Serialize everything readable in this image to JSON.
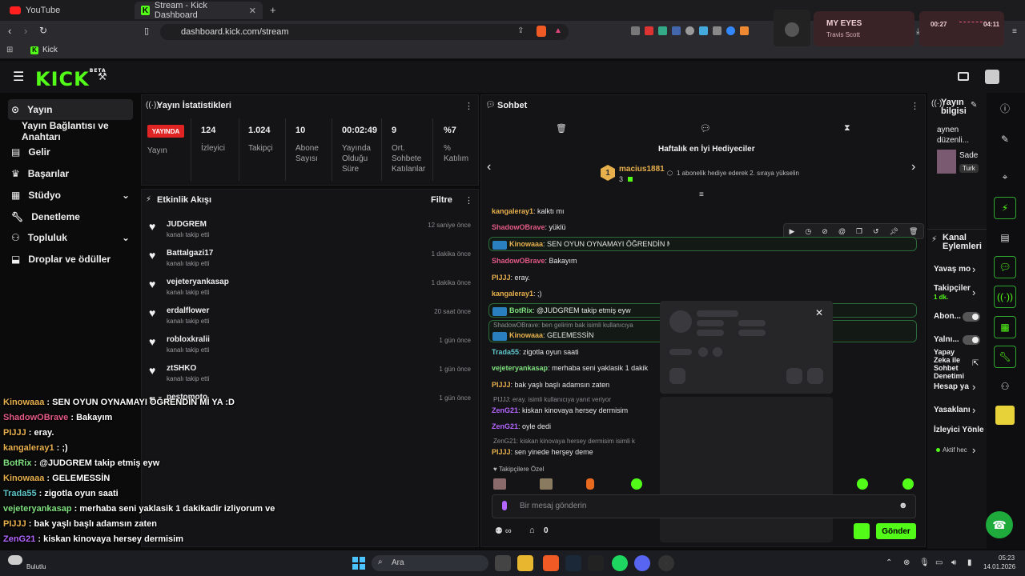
{
  "browser": {
    "tabs": [
      "YouTube",
      "Stream - Kick Dashboard"
    ],
    "url": "dashboard.kick.com/stream",
    "bookmark": "Kick"
  },
  "media": {
    "title": "MY EYES",
    "artist": "Travis Scott",
    "elapsed": "00:27",
    "total": "04:11"
  },
  "nav": {
    "items": [
      "Yayın",
      "Yayın Bağlantısı ve Anahtarı",
      "Gelir",
      "Başarılar",
      "Stüdyo",
      "Denetleme",
      "Topluluk",
      "Droplar ve ödüller"
    ]
  },
  "stats": {
    "title": "Yayın İstatistikleri",
    "live": "YAYINDA",
    "live_label": "Yayın",
    "items": [
      {
        "value": "124",
        "label": "İzleyici"
      },
      {
        "value": "1.024",
        "label": "Takipçi"
      },
      {
        "value": "10",
        "label": "Abone Sayısı"
      },
      {
        "value": "00:02:49",
        "label": "Yayında Olduğu Süre"
      },
      {
        "value": "9",
        "label": "Ort. Sohbete Katılanlar"
      },
      {
        "value": "%7",
        "label": "% Katılım"
      }
    ]
  },
  "feed": {
    "title": "Etkinlik Akışı",
    "filter": "Filtre",
    "events": [
      {
        "name": "JUDGREM",
        "sub": "kanalı takip etti",
        "time": "12 saniye önce"
      },
      {
        "name": "Battalgazi17",
        "sub": "kanalı takip etti",
        "time": "1 dakika önce"
      },
      {
        "name": "vejeteryankasap",
        "sub": "kanalı takip etti",
        "time": "1 dakika önce"
      },
      {
        "name": "erdalflower",
        "sub": "kanalı takip etti",
        "time": "20 saat önce"
      },
      {
        "name": "robloxkralii",
        "sub": "kanalı takip etti",
        "time": "1 gün önce"
      },
      {
        "name": "ztSHKO",
        "sub": "kanalı takip etti",
        "time": "1 gün önce"
      },
      {
        "name": "pestomoto",
        "sub": "",
        "time": "1 gün önce"
      }
    ]
  },
  "chat": {
    "title": "Sohbet",
    "gifters_title": "Haftalık en İyi Hediyeciler",
    "top_gifter": "macius1881",
    "top_gifter_count": "3",
    "gifter_hint": "1 abonelik hediye ederek 2. sıraya yükselin",
    "followers_only": "Takipçilere Özel",
    "placeholder": "Bir mesaj gönderin",
    "send": "Gönder",
    "count": "0",
    "messages": [
      {
        "user": "kangaleray1",
        "text": ": kalktı mı",
        "cls": "u-orange"
      },
      {
        "user": "ShadowOBrave",
        "text": ": yüklü",
        "cls": "u-pink"
      },
      {
        "user": "Kinowaaa",
        "text": ": SEN OYUN OYNAMAYI ÖĞRENDİN Mİ YA :D",
        "cls": "u-orange"
      },
      {
        "user": "ShadowOBrave",
        "text": ": Bakayım",
        "cls": "u-pink"
      },
      {
        "user": "PIJJJ",
        "text": ": eray.",
        "cls": "u-orange"
      },
      {
        "user": "kangaleray1",
        "text": ": ;)",
        "cls": "u-orange"
      },
      {
        "user": "BotRix",
        "text": ": @JUDGREM takip etmiş eyw",
        "cls": "u-lime"
      },
      {
        "user": "ShadowOBrave: ben gelirim bak isimli kullanıcıya",
        "text": "",
        "cls": ""
      },
      {
        "user": "Kinowaaa",
        "text": ": GELEMESSİN",
        "cls": "u-orange"
      },
      {
        "user": "Trada55",
        "text": ": zigotla oyun saati",
        "cls": "u-teal"
      },
      {
        "user": "vejeteryankasap",
        "text": ": merhaba seni yaklasik 1 dakik",
        "cls": "u-lime"
      },
      {
        "user": "PIJJJ",
        "text": ": bak yaşlı başlı adamsın zaten",
        "cls": "u-orange"
      },
      {
        "user": "PIJJJ: eray. isimli kullanıcıya yanıt veriyor",
        "text": "",
        "cls": ""
      },
      {
        "user": "ZenG21",
        "text": ": kiskan kinovaya hersey dermisim",
        "cls": "u-violet"
      },
      {
        "user": "ZenG21",
        "text": ": oyle dedi",
        "cls": "u-violet"
      },
      {
        "user": "ZenG21: kiskan kinovaya hersey dermisim isimli k",
        "text": "",
        "cls": ""
      },
      {
        "user": "PIJJJ",
        "text": ": sen yinede herşey deme",
        "cls": "u-orange"
      }
    ]
  },
  "overlay": [
    {
      "user": "Kinowaaa",
      "text": " : SEN OYUN OYNAMAYI ÖĞRENDİN Mİ YA :D",
      "color": "#e8b04d"
    },
    {
      "user": "ShadowOBrave",
      "text": " : Bakayım",
      "color": "#e35a86"
    },
    {
      "user": "PIJJJ",
      "text": " : eray.",
      "color": "#e8b04d"
    },
    {
      "user": "kangaleray1",
      "text": " : ;)",
      "color": "#e8b04d"
    },
    {
      "user": "BotRix",
      "text": " : @JUDGREM takip etmiş eyw",
      "color": "#7fe07f"
    },
    {
      "user": "Kinowaaa",
      "text": " : GELEMESSİN",
      "color": "#e8b04d"
    },
    {
      "user": "Trada55",
      "text": " : zigotla oyun saati",
      "color": "#5fc6c9"
    },
    {
      "user": "vejeteryankasap",
      "text": " : merhaba seni yaklasik 1 dakikadir izliyorum ve",
      "color": "#7fe07f"
    },
    {
      "user": "PIJJJ",
      "text": " : bak yaşlı başlı adamsın zaten",
      "color": "#e8b04d"
    },
    {
      "user": "ZenG21",
      "text": " : kiskan kinovaya hersey dermisim",
      "color": "#b366ff"
    },
    {
      "user": "ZenG21",
      "text": " : oyle dedi",
      "color": "#b366ff"
    }
  ],
  "info": {
    "title": "Yayın bilgisi",
    "desc": "aynen düzenli...",
    "cat": "Sade",
    "tag": "Turk"
  },
  "actions": {
    "title": "Kanal Eylemleri",
    "slow": "Yavaş mo",
    "followers": "Takipçiler",
    "followers_val": "1 dk.",
    "subs": "Abon...",
    "only": "Yalnı...",
    "ai": "Yapay Zeka ile Sohbet Denetimi",
    "account": "Hesap ya",
    "banned": "Yasaklanı",
    "viewer": "İzleyici Yönle",
    "active": "Aktif hec"
  },
  "taskbar": {
    "search": "Ara",
    "weather": "Bulutlu",
    "time": "05:23",
    "date": "14.01.2026"
  }
}
